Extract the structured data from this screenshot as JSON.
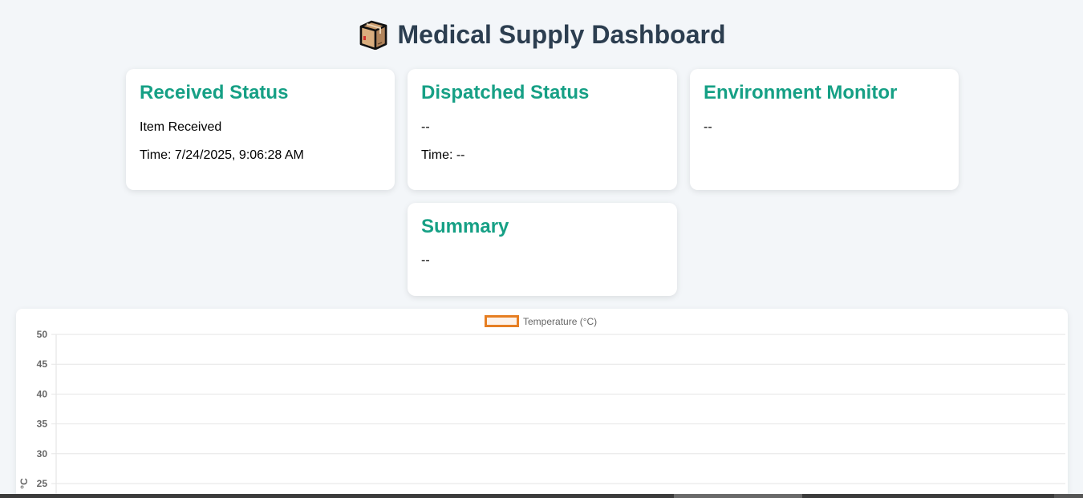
{
  "header": {
    "title": "Medical Supply Dashboard",
    "icon": "package-box-icon"
  },
  "cards": {
    "received": {
      "title": "Received Status",
      "status": "Item Received",
      "time": "Time: 7/24/2025, 9:06:28 AM"
    },
    "dispatched": {
      "title": "Dispatched Status",
      "status": "--",
      "time": "Time: --"
    },
    "environment": {
      "title": "Environment Monitor",
      "status": "--"
    },
    "summary": {
      "title": "Summary",
      "status": "--"
    }
  },
  "colors": {
    "heading": "#2c3e50",
    "card_title": "#16a085",
    "series": "#e67e22",
    "background": "#f3f6f9"
  },
  "chart_data": {
    "type": "line",
    "title": "",
    "ylabel": "°C",
    "xlabel": "",
    "ylim": [
      25,
      50
    ],
    "y_ticks": [
      "50",
      "45",
      "40",
      "35",
      "30",
      "25"
    ],
    "grid": true,
    "legend_position": "top-center",
    "categories": [],
    "series": [
      {
        "name": "Temperature (°C)",
        "values": []
      }
    ]
  }
}
